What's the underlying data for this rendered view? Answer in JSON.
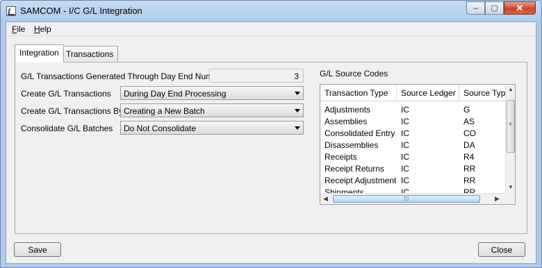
{
  "window": {
    "title": "SAMCOM - I/C G/L Integration",
    "minimize": "–",
    "maximize": "▢",
    "close": "✕"
  },
  "menu": {
    "items": [
      "File",
      "Help"
    ]
  },
  "tabs": [
    {
      "label": "Integration",
      "active": true
    },
    {
      "label": "Transactions",
      "active": false
    }
  ],
  "form": {
    "day_end_label": "G/L Transactions Generated Through Day End Number",
    "day_end_value": "3",
    "create_label": "Create G/L Transactions",
    "create_value": "During Day End Processing",
    "create_by_label": "Create G/L Transactions By",
    "create_by_value": "Creating a New Batch",
    "consolidate_label": "Consolidate G/L Batches",
    "consolidate_value": "Do Not Consolidate"
  },
  "source_codes": {
    "title": "G/L Source Codes",
    "columns": [
      "Transaction Type",
      "Source Ledger",
      "Source Type"
    ],
    "rows": [
      [
        "Adjustments",
        "IC",
        "G"
      ],
      [
        "Assemblies",
        "IC",
        "AS"
      ],
      [
        "Consolidated Entry",
        "IC",
        "CO"
      ],
      [
        "Disassemblies",
        "IC",
        "DA"
      ],
      [
        "Receipts",
        "IC",
        "R4"
      ],
      [
        "Receipt Returns",
        "IC",
        "RR"
      ],
      [
        "Receipt Adjustments",
        "IC",
        "RR"
      ],
      [
        "Shipments",
        "IC",
        "RR"
      ]
    ]
  },
  "buttons": {
    "save": "Save",
    "close": "Close"
  },
  "icons": {
    "app": "app-window-icon",
    "dropdown": "chevron-down-icon",
    "scroll_up": "scroll-up-icon",
    "scroll_down": "scroll-down-icon",
    "scroll_left": "scroll-left-icon",
    "scroll_right": "scroll-right-icon"
  }
}
